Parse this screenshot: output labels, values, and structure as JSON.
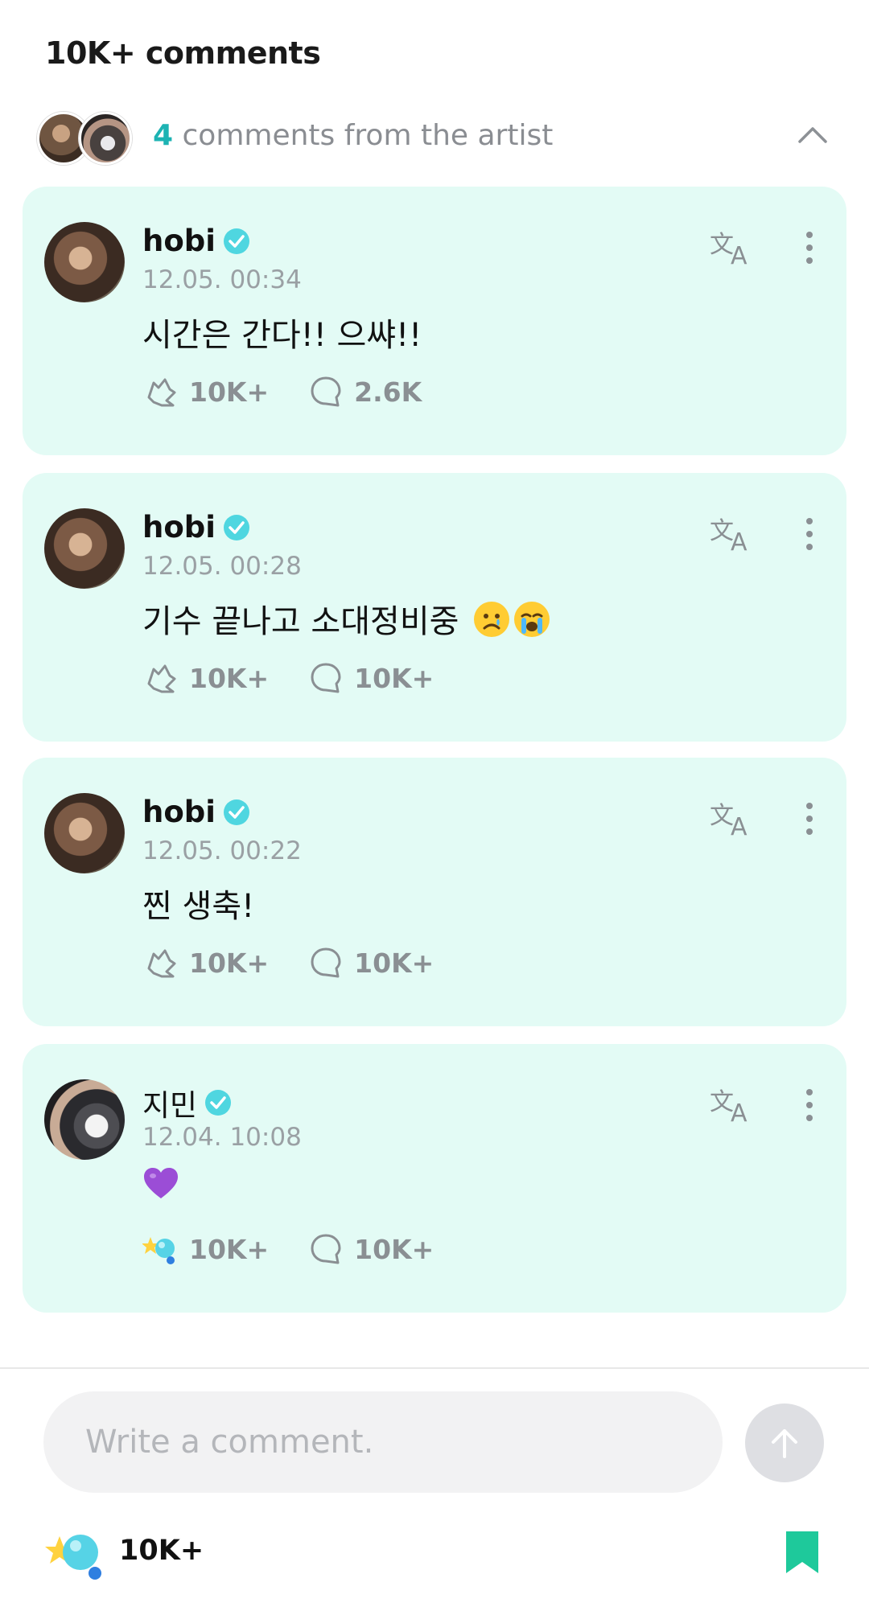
{
  "header": {
    "title": "10K+ comments"
  },
  "artist_bar": {
    "count": "4",
    "label": " comments from the artist"
  },
  "comments": [
    {
      "name": "hobi",
      "time": "12.05. 00:34",
      "text": "시간은 간다!! 으쌰!!",
      "likes": "10K+",
      "replies": "2.6K",
      "avatar": "hobi"
    },
    {
      "name": "hobi",
      "time": "12.05. 00:28",
      "text": "기수 끝나고 소대정비중 ",
      "likes": "10K+",
      "replies": "10K+",
      "avatar": "hobi",
      "emoji": [
        "sad-face",
        "crying-face"
      ]
    },
    {
      "name": "hobi",
      "time": "12.05. 00:22",
      "text": "찐 생축!",
      "likes": "10K+",
      "replies": "10K+",
      "avatar": "hobi"
    },
    {
      "name": "지민",
      "time": "12.04. 10:08",
      "text": "",
      "likes": "10K+",
      "replies": "10K+",
      "avatar": "jimin",
      "emoji": [
        "purple-heart"
      ]
    }
  ],
  "composer": {
    "placeholder": "Write a comment."
  },
  "footer": {
    "cheer_count": "10K+"
  },
  "colors": {
    "card_bg": "#e3fbf5",
    "accent": "#1db3b3",
    "verified": "#4fd6e0",
    "bookmark": "#1ec99b"
  }
}
